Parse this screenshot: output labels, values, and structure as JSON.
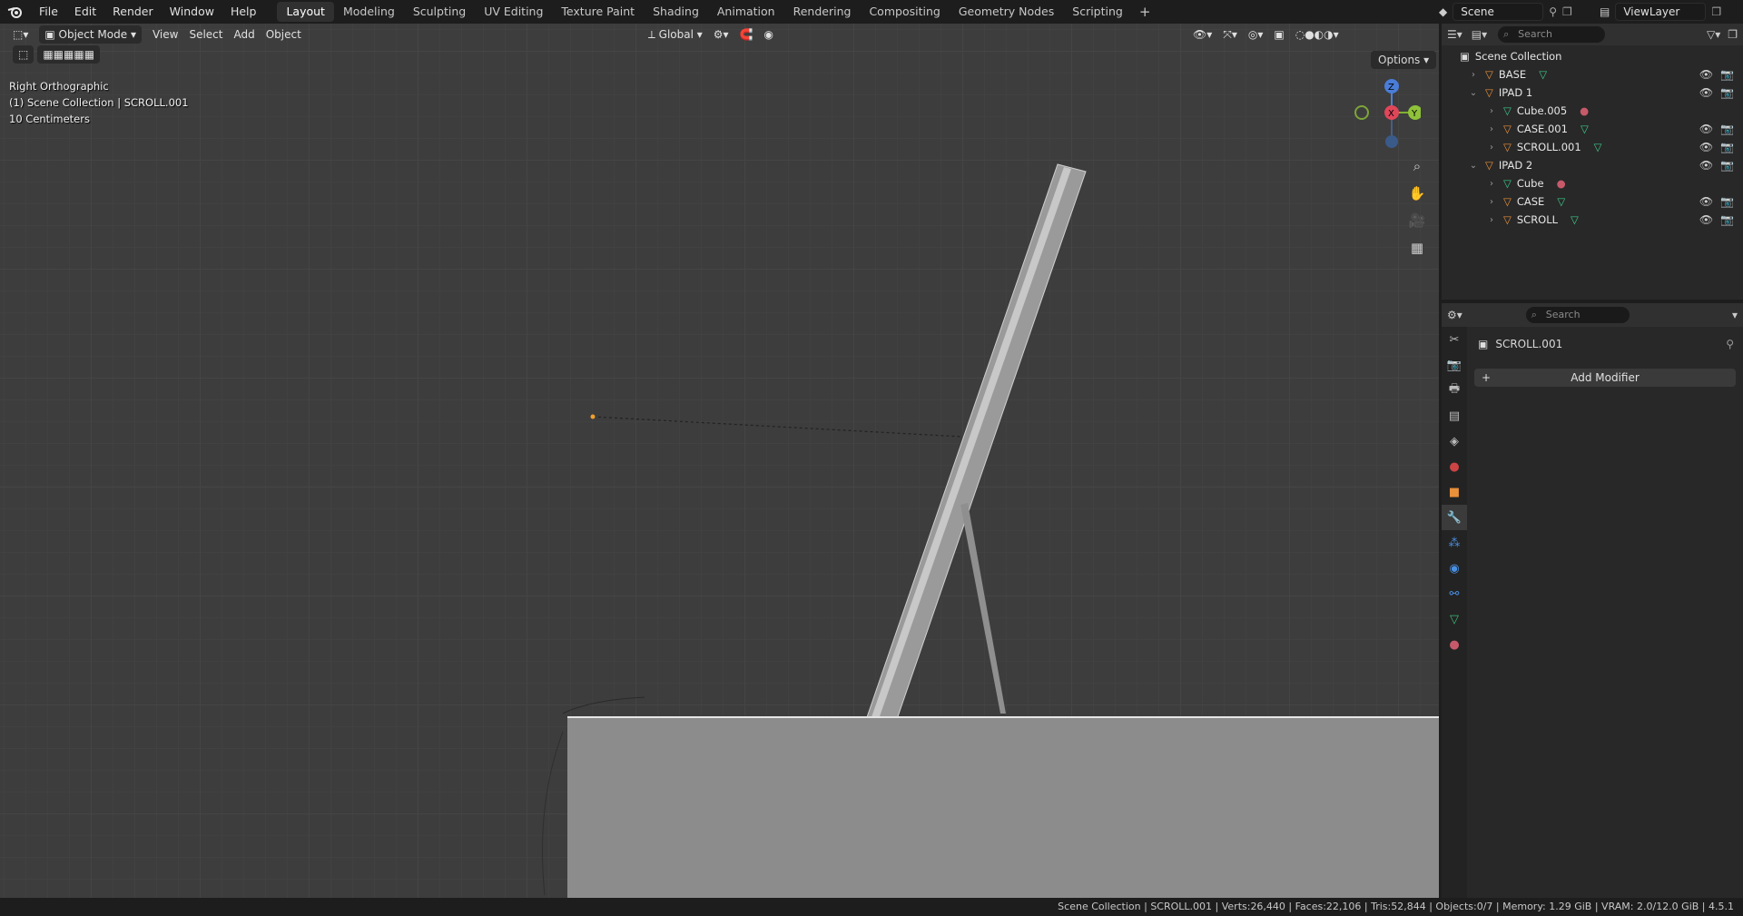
{
  "menu": [
    "File",
    "Edit",
    "Render",
    "Window",
    "Help"
  ],
  "workspaces": [
    "Layout",
    "Modeling",
    "Sculpting",
    "UV Editing",
    "Texture Paint",
    "Shading",
    "Animation",
    "Rendering",
    "Compositing",
    "Geometry Nodes",
    "Scripting"
  ],
  "active_workspace": "Layout",
  "scene_name": "Scene",
  "view_layer": "ViewLayer",
  "viewport": {
    "mode": "Object Mode",
    "menus": [
      "View",
      "Select",
      "Add",
      "Object"
    ],
    "transform_orientation": "Global",
    "options_label": "Options",
    "info_view": "Right Orthographic",
    "info_collection": "(1) Scene Collection | SCROLL.001",
    "info_scale": "10 Centimeters",
    "gizmo_axes": {
      "z": "Z",
      "x": "X",
      "y": "Y"
    }
  },
  "outliner": {
    "search_placeholder": "Search",
    "root": "Scene Collection",
    "rows": [
      {
        "label": "BASE",
        "type": "object",
        "indent": 0,
        "expanded": false,
        "visible": true
      },
      {
        "label": "IPAD 1",
        "type": "object",
        "indent": 0,
        "expanded": true,
        "visible": true
      },
      {
        "label": "Cube.005",
        "type": "mesh",
        "indent": 1,
        "expanded": false,
        "visible": false
      },
      {
        "label": "CASE.001",
        "type": "object",
        "indent": 1,
        "expanded": false,
        "visible": true
      },
      {
        "label": "SCROLL.001",
        "type": "object",
        "indent": 1,
        "expanded": false,
        "visible": true
      },
      {
        "label": "IPAD 2",
        "type": "object",
        "indent": 0,
        "expanded": true,
        "visible": true
      },
      {
        "label": "Cube",
        "type": "mesh",
        "indent": 1,
        "expanded": false,
        "visible": false
      },
      {
        "label": "CASE",
        "type": "object",
        "indent": 1,
        "expanded": false,
        "visible": true
      },
      {
        "label": "SCROLL",
        "type": "object",
        "indent": 1,
        "expanded": false,
        "visible": true
      }
    ]
  },
  "properties": {
    "search_placeholder": "Search",
    "object_name": "SCROLL.001",
    "add_modifier_label": "Add Modifier"
  },
  "status": "Scene Collection | SCROLL.001 | Verts:26,440 | Faces:22,106 | Tris:52,844 | Objects:0/7 | Memory: 1.29 GiB | VRAM: 2.0/12.0 GiB | 4.5.1"
}
